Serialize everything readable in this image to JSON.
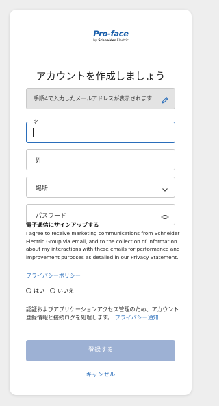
{
  "brand": {
    "logo_main": "Pro-face",
    "logo_by": "by ",
    "logo_company": "Schneider",
    "logo_tail": " Electric",
    "color": "#1b5faa"
  },
  "title": "アカウントを作成しましょう",
  "email_notice": "手順4で入力したメールアドレスが表示されます",
  "fields": {
    "first_name": {
      "label": "名",
      "value": ""
    },
    "last_name": {
      "placeholder": "姓"
    },
    "location": {
      "placeholder": "場所"
    },
    "password": {
      "placeholder": "パスワード"
    }
  },
  "consent": {
    "heading": "電子通信にサインアップする",
    "text": "I agree to receive marketing communications from Schneider Electric Group via email, and to the collection of information about my interactions with these emails for performance and improvement purposes as detailed in our Privacy Statement.",
    "privacy_link": "プライバシーポリシー",
    "options": [
      "はい",
      "いいえ"
    ]
  },
  "notice": {
    "text": "認証およびアプリケーションアクセス管理のため、アカウント登録情報と接続ログを処理します。 ",
    "link": "プライバシー通知"
  },
  "actions": {
    "submit": "登録する",
    "cancel": "キャンセル"
  },
  "colors": {
    "accent": "#2a6ebb",
    "submit_disabled": "#9db1d4"
  }
}
